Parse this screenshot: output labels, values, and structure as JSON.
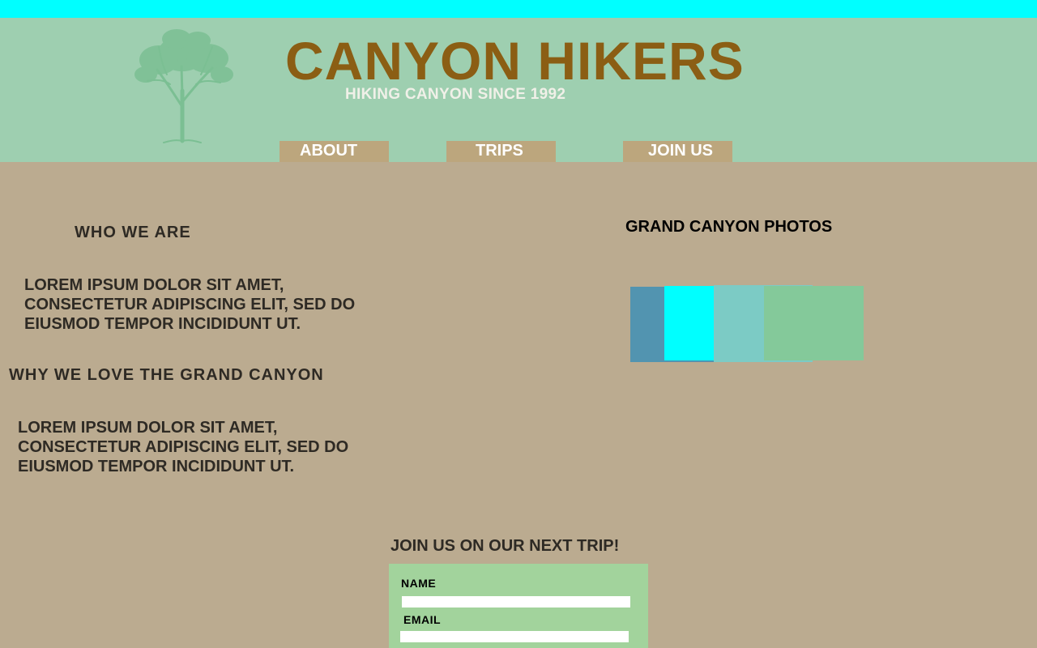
{
  "header": {
    "title": "CANYON HIKERS",
    "tagline": "HIKING CANYON SINCE 1992",
    "logo_icon": "tree-icon"
  },
  "nav": {
    "items": [
      {
        "label": "ABOUT"
      },
      {
        "label": "TRIPS"
      },
      {
        "label": "JOIN US"
      }
    ]
  },
  "about": {
    "who_heading": "WHO WE ARE",
    "who_text": "LOREM IPSUM DOLOR SIT AMET, CONSECTETUR ADIPISCING ELIT, SED DO EIUSMOD TEMPOR INCIDIDUNT UT.",
    "why_heading": "WHY WE LOVE THE GRAND CANYON",
    "why_text": "LOREM IPSUM DOLOR SIT AMET, CONSECTETUR ADIPISCING ELIT, SED DO EIUSMOD TEMPOR INCIDIDUNT UT."
  },
  "photos": {
    "heading": "GRAND CANYON PHOTOS"
  },
  "join": {
    "heading": "JOIN US ON OUR NEXT TRIP!",
    "name_label": "NAME",
    "name_value": "",
    "email_label": "EMAIL",
    "email_value": ""
  },
  "colors": {
    "topbar": "#00ffff",
    "header_bg": "#9ecfb0",
    "title": "#8b5e14",
    "nav_bg": "#bca67d",
    "page_bg": "#bbab90",
    "form_bg": "#a2d39c",
    "photo_1": "#5294b0",
    "photo_2": "#00ffff",
    "photo_3": "#7ccbc5",
    "photo_4": "#84c99a"
  }
}
